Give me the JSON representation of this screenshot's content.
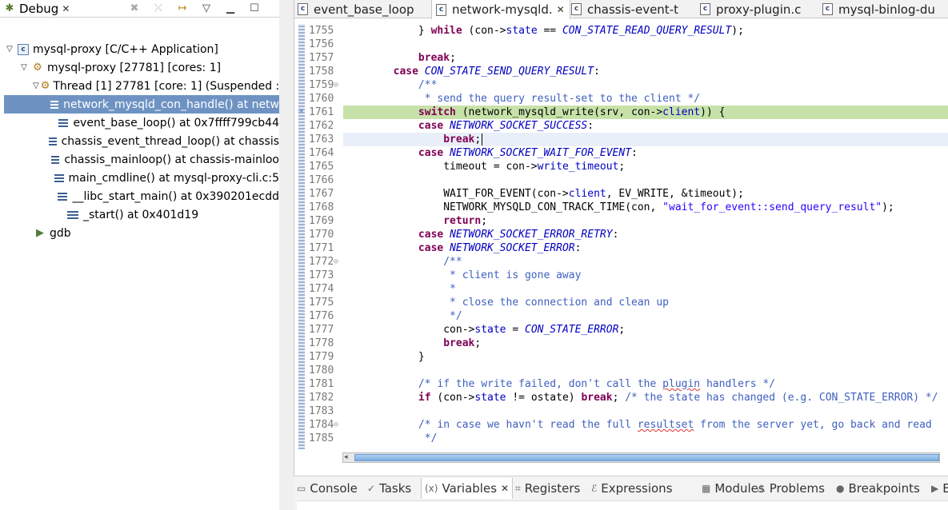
{
  "debug_view": {
    "tab_label": "Debug",
    "tree": {
      "app": "mysql-proxy [C/C++ Application]",
      "process": "mysql-proxy [27781] [cores: 1]",
      "thread": "Thread [1] 27781 [core: 1] (Suspended : S",
      "frames": [
        "network_mysqld_con_handle() at netw",
        "event_base_loop() at 0x7ffff799cb44",
        "chassis_event_thread_loop() at chassis",
        "chassis_mainloop() at chassis-mainloo",
        "main_cmdline() at mysql-proxy-cli.c:5",
        "__libc_start_main() at 0x390201ecdd",
        "_start() at 0x401d19"
      ],
      "gdb": "gdb"
    }
  },
  "editor": {
    "tabs": [
      {
        "label": "event_base_loop",
        "active": false
      },
      {
        "label": "network-mysqld.",
        "active": true
      },
      {
        "label": "chassis-event-t",
        "active": false
      },
      {
        "label": "proxy-plugin.c",
        "active": false
      },
      {
        "label": "mysql-binlog-du",
        "active": false
      }
    ],
    "file_icon_letter": "c",
    "lines": [
      {
        "n": "1755",
        "t": "            } while (con->state == CON_STATE_READ_QUERY_RESULT);"
      },
      {
        "n": "1756",
        "t": ""
      },
      {
        "n": "1757",
        "t": "            break;"
      },
      {
        "n": "1758",
        "t": "        case CON_STATE_SEND_QUERY_RESULT:"
      },
      {
        "n": "1759",
        "t": "            /**",
        "fold": true
      },
      {
        "n": "1760",
        "t": "             * send the query result-set to the client */"
      },
      {
        "n": "1761",
        "t": "            switch (network_mysqld_write(srv, con->client)) {",
        "current": true
      },
      {
        "n": "1762",
        "t": "            case NETWORK_SOCKET_SUCCESS:"
      },
      {
        "n": "1763",
        "t": "                break;",
        "caret": true
      },
      {
        "n": "1764",
        "t": "            case NETWORK_SOCKET_WAIT_FOR_EVENT:"
      },
      {
        "n": "1765",
        "t": "                timeout = con->write_timeout;"
      },
      {
        "n": "1766",
        "t": ""
      },
      {
        "n": "1767",
        "t": "                WAIT_FOR_EVENT(con->client, EV_WRITE, &timeout);"
      },
      {
        "n": "1768",
        "t": "                NETWORK_MYSQLD_CON_TRACK_TIME(con, \"wait_for_event::send_query_result\");"
      },
      {
        "n": "1769",
        "t": "                return;"
      },
      {
        "n": "1770",
        "t": "            case NETWORK_SOCKET_ERROR_RETRY:"
      },
      {
        "n": "1771",
        "t": "            case NETWORK_SOCKET_ERROR:"
      },
      {
        "n": "1772",
        "t": "                /**",
        "fold": true
      },
      {
        "n": "1773",
        "t": "                 * client is gone away"
      },
      {
        "n": "1774",
        "t": "                 *"
      },
      {
        "n": "1775",
        "t": "                 * close the connection and clean up"
      },
      {
        "n": "1776",
        "t": "                 */"
      },
      {
        "n": "1777",
        "t": "                con->state = CON_STATE_ERROR;"
      },
      {
        "n": "1778",
        "t": "                break;"
      },
      {
        "n": "1779",
        "t": "            }"
      },
      {
        "n": "1780",
        "t": ""
      },
      {
        "n": "1781",
        "t": "            /* if the write failed, don't call the plugin handlers */"
      },
      {
        "n": "1782",
        "t": "            if (con->state != ostate) break; /* the state has changed (e.g. CON_STATE_ERROR) */"
      },
      {
        "n": "1783",
        "t": ""
      },
      {
        "n": "1784",
        "t": "            /* in case we havn't read the full resultset from the server yet, go back and read",
        "fold": true
      },
      {
        "n": "1785",
        "t": "             */"
      }
    ]
  },
  "bottom_tabs": [
    {
      "label": "Console",
      "icon": "console-icon",
      "glyph": "▭"
    },
    {
      "label": "Tasks",
      "icon": "tasks-icon",
      "glyph": "✓"
    },
    {
      "label": "Variables",
      "icon": "variables-icon",
      "glyph": "(x)",
      "active": true
    },
    {
      "label": "Registers",
      "icon": "registers-icon",
      "glyph": "⌗"
    },
    {
      "label": "Expressions",
      "icon": "expressions-icon",
      "glyph": "ℰ"
    },
    {
      "label": "Modules",
      "icon": "modules-icon",
      "glyph": "▦"
    },
    {
      "label": "Problems",
      "icon": "problems-icon",
      "glyph": "⚠"
    },
    {
      "label": "Breakpoints",
      "icon": "breakpoints-icon",
      "glyph": "●"
    },
    {
      "label": "E",
      "icon": "more-icon",
      "glyph": "▶"
    }
  ]
}
